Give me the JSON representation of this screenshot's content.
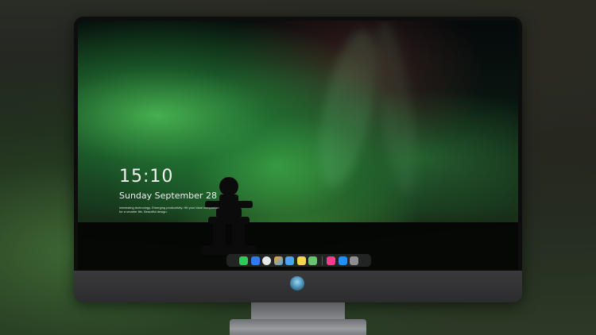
{
  "lockscreen": {
    "time": "15:10",
    "date": "Sunday September 28",
    "note": "Interesting technology. Emerging productivity. Hit your ideal companion for a smarter life. Beautiful design."
  },
  "dock": {
    "items": [
      {
        "name": "messages-icon",
        "color": "#34c759"
      },
      {
        "name": "mail-icon",
        "color": "#2f7bf5"
      },
      {
        "name": "safari-icon",
        "color": "#e8e8e8"
      },
      {
        "name": "photos-icon",
        "color": "#f5a623"
      },
      {
        "name": "finder-icon",
        "color": "#4aa3f0"
      },
      {
        "name": "notes-icon",
        "color": "#f7d54a"
      },
      {
        "name": "maps-icon",
        "color": "#6ac36f"
      },
      {
        "name": "music-icon",
        "color": "#fc3c8d"
      },
      {
        "name": "app-store-icon",
        "color": "#1e90ff"
      },
      {
        "name": "camera-icon",
        "color": "#8e8e93"
      }
    ]
  },
  "colors": {
    "aurora_green": "#50c85a",
    "bezel": "#0d0d0e",
    "chin": "#3a3a3c"
  }
}
